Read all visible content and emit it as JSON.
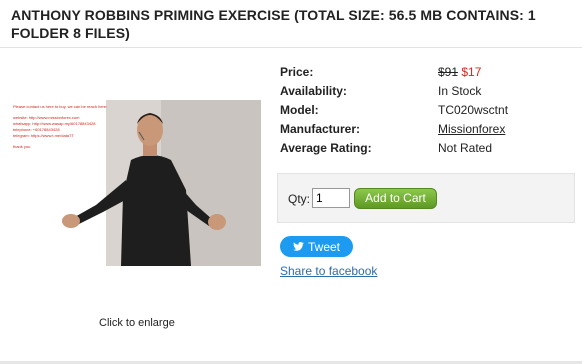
{
  "product": {
    "title": "ANTHONY ROBBINS PRIMING EXERCISE (TOTAL SIZE: 56.5 MB CONTAINS: 1 FOLDER 8 FILES)",
    "enlarge_label": "Click to enlarge",
    "image_watermark": [
      "Please contact us here to buy, we can be reach here:",
      "website: http://www.missionforex.com",
      "whatsapp: http://www.wasap.my/60178843428",
      "telephone: +60178843428",
      "telegram: https://www.t.me/dataTT",
      "thank you"
    ]
  },
  "details": {
    "price_label": "Price:",
    "old_price": "$91",
    "new_price": "$17",
    "availability_label": "Availability:",
    "availability_value": "In Stock",
    "model_label": "Model:",
    "model_value": "TC020wsctnt",
    "manufacturer_label": "Manufacturer:",
    "manufacturer_value": "Missionforex",
    "rating_label": "Average Rating:",
    "rating_value": "Not Rated"
  },
  "cart": {
    "qty_label": "Qty:",
    "qty_value": "1",
    "add_button": "Add to Cart"
  },
  "social": {
    "tweet_label": "Tweet",
    "facebook_label": "Share to facebook"
  },
  "colors": {
    "price_red": "#e0241c",
    "link_blue": "#2f6ca8",
    "cart_green": "#6aa82c",
    "tweet_blue": "#1d9bf0"
  }
}
